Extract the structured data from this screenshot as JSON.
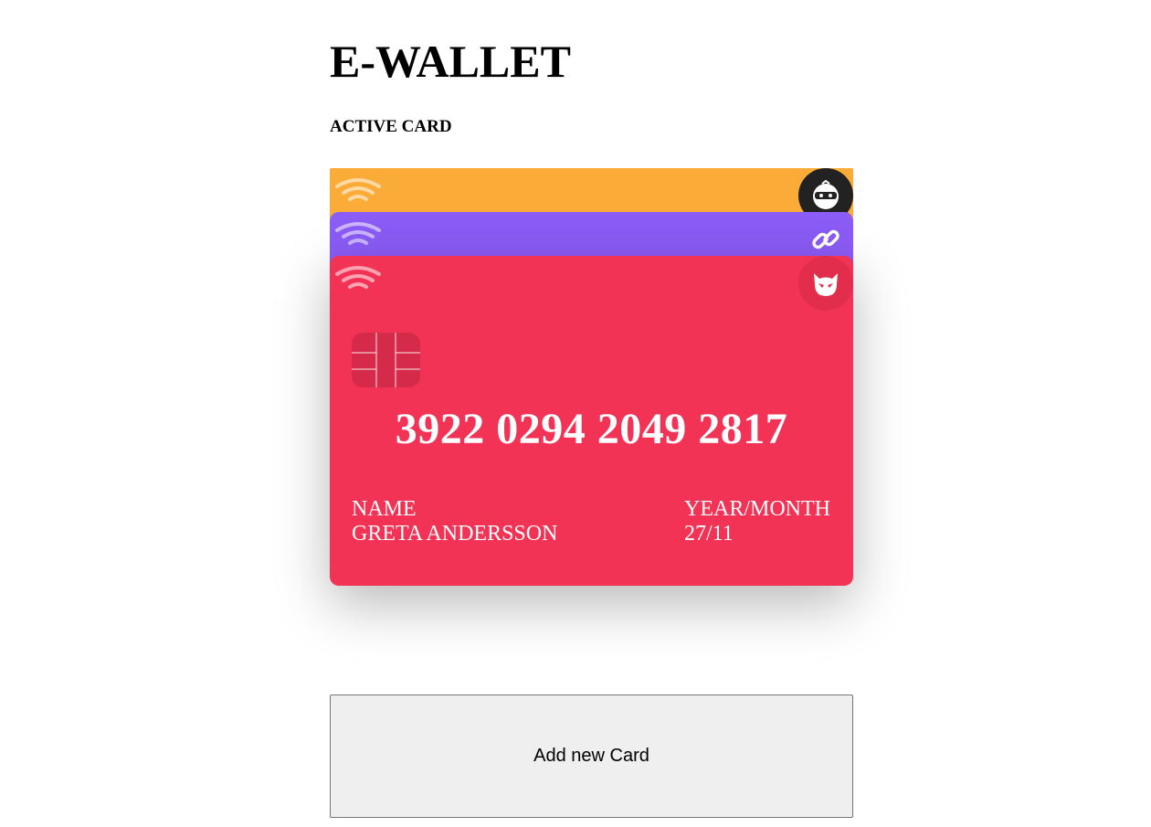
{
  "header": {
    "title": "E-WALLET",
    "subtitle": "ACTIVE CARD"
  },
  "cards": [
    {
      "color": "#fbab37",
      "vendor_icon": "bitcoin-ninja-icon",
      "vendor_badge_color": "#222222"
    },
    {
      "color": "#8b5cf6",
      "vendor_icon": "chain-link-icon",
      "vendor_badge_color": "#8b5cf6"
    },
    {
      "color": "#f33355",
      "vendor_icon": "evil-corp-icon",
      "vendor_badge_color": "#e22d4c",
      "number": "3922 0294 2049 2817",
      "name_label": "NAME",
      "name": "GRETA ANDERSSON",
      "expiry_label": "YEAR/MONTH",
      "expiry": "27/11"
    }
  ],
  "actions": {
    "add_card_label": "Add new Card"
  }
}
